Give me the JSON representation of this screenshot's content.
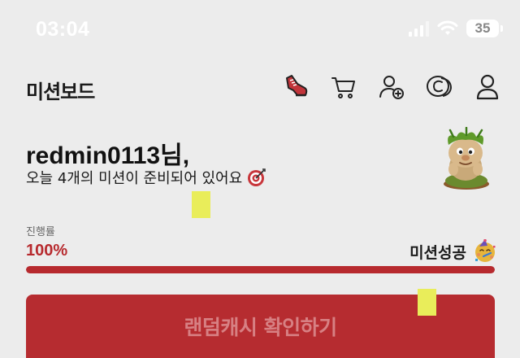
{
  "status_bar": {
    "time": "03:04",
    "battery": "35",
    "icons": [
      "signal-icon",
      "wifi-icon",
      "battery-icon"
    ]
  },
  "header": {
    "title": "미션보드",
    "icons": [
      "shoe-icon",
      "cart-icon",
      "add-friend-icon",
      "coin-icon",
      "profile-icon"
    ]
  },
  "greeting": {
    "username": "redmin0113님,",
    "subtitle": "오늘 4개의 미션이 준비되어 있어요"
  },
  "progress": {
    "label": "진행률",
    "value_text": "100%",
    "fraction": 1.0,
    "status": "미션성공"
  },
  "actions": {
    "random_cash_label": "랜덤캐시 확인하기"
  },
  "colors": {
    "accent": "#b72a2e",
    "background": "#ececec",
    "marker": "#e9ed5a"
  }
}
